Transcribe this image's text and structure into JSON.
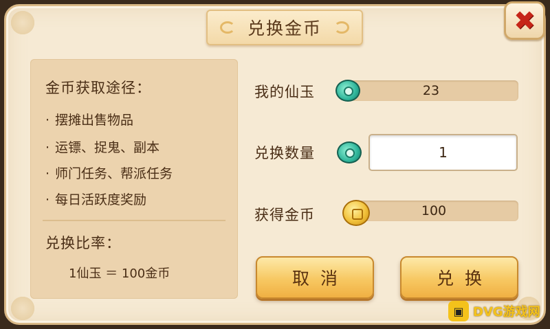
{
  "dialog": {
    "title": "兑换金币",
    "close_label": "✖"
  },
  "info": {
    "sources_heading": "金币获取途径：",
    "sources": [
      "摆摊出售物品",
      "运镖、捉鬼、副本",
      "师门任务、帮派任务",
      "每日活跃度奖励"
    ],
    "bullet": "·",
    "rate_heading": "兑换比率：",
    "rate_text": "1仙玉 ＝ 100金币"
  },
  "exchange": {
    "my_jade_label": "我的仙玉",
    "my_jade_value": "23",
    "quantity_label": "兑换数量",
    "quantity_value": "1",
    "gain_label": "获得金币",
    "gain_value": "100"
  },
  "buttons": {
    "cancel": "取消",
    "confirm": "兑换"
  },
  "watermark": {
    "icon": "gamepad-icon",
    "text": "DVG游戏网"
  },
  "colors": {
    "panel_bg": "#f6ead4",
    "button_gold": "#f7c862",
    "close_red": "#c62518",
    "jade_green": "#2fb59a"
  }
}
